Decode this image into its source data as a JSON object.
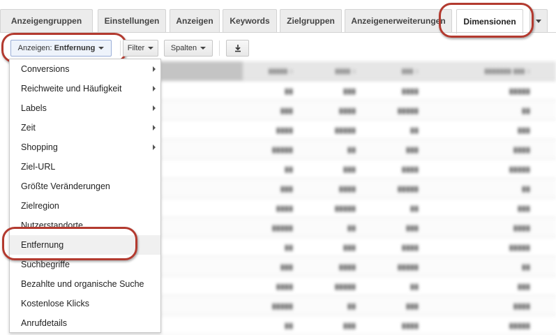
{
  "tabs": [
    {
      "label": "Anzeigengruppen"
    },
    {
      "label": "Einstellungen"
    },
    {
      "label": "Anzeigen"
    },
    {
      "label": "Keywords"
    },
    {
      "label": "Zielgruppen"
    },
    {
      "label": "Anzeigenerweiterungen"
    },
    {
      "label": "Dimensionen",
      "active": true
    }
  ],
  "tab_more_icon": "chevron-down-icon",
  "toolbar": {
    "view_prefix": "Anzeigen: ",
    "view_value": "Entfernung",
    "filter_label": "Filter",
    "columns_label": "Spalten",
    "download_icon": "download-icon"
  },
  "menu": {
    "items": [
      {
        "label": "Conversions",
        "submenu": true
      },
      {
        "label": "Reichweite und Häufigkeit",
        "submenu": true
      },
      {
        "label": "Labels",
        "submenu": true
      },
      {
        "label": "Zeit",
        "submenu": true
      },
      {
        "label": "Shopping",
        "submenu": true
      },
      {
        "label": "Ziel-URL",
        "submenu": false
      },
      {
        "label": "Größte Veränderungen",
        "submenu": false
      },
      {
        "label": "Zielregion",
        "submenu": false
      },
      {
        "label": "Nutzerstandorte",
        "submenu": false
      },
      {
        "label": "Entfernung",
        "submenu": false,
        "selected": true
      },
      {
        "label": "Suchbegriffe",
        "submenu": false
      },
      {
        "label": "Bezahlte und organische Suche",
        "submenu": false
      },
      {
        "label": "Kostenlose Klicks",
        "submenu": false
      },
      {
        "label": "Anrufdetails",
        "submenu": false
      }
    ]
  },
  "colors": {
    "highlight_ring": "#b33a2f",
    "active_tab_bg": "#ffffff",
    "tab_bg": "#ececec"
  }
}
